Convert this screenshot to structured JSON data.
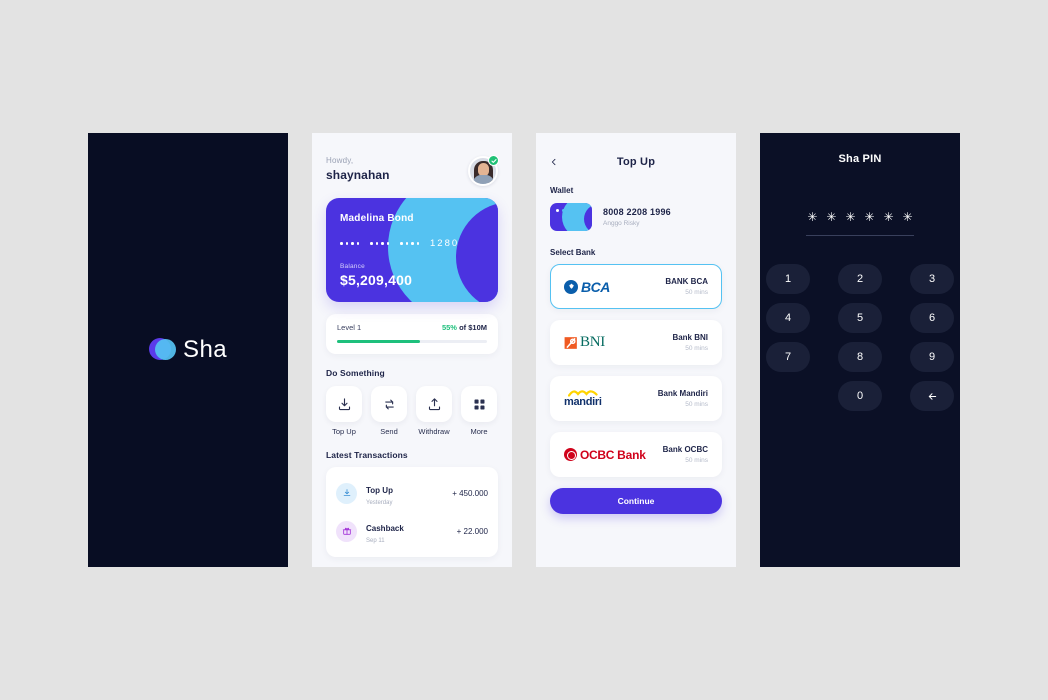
{
  "splash": {
    "brand": "Sha",
    "logo_icon": "sha-logo-icon",
    "bg_color": "#080d23",
    "purple": "#5b3bea",
    "cyan": "#55c2f2"
  },
  "home": {
    "greeting": "Howdy,",
    "username": "shaynahan",
    "avatar_icon": "avatar",
    "verified_icon": "verified-check-icon",
    "card": {
      "holder": "Madelina Bond",
      "masked_groups": [
        "••••",
        "••••",
        "••••"
      ],
      "last4": "1280",
      "balance_label": "Balance",
      "balance": "$5,209,400",
      "bg_color": "#4b33e0",
      "accent_color": "#55c2f2"
    },
    "level": {
      "label": "Level 1",
      "percent_text": "55%",
      "of_text": " of $10M",
      "progress": 55,
      "bar_color": "#1ec07c"
    },
    "do_something_title": "Do Something",
    "actions": [
      {
        "label": "Top Up",
        "icon": "download-tray-icon"
      },
      {
        "label": "Send",
        "icon": "swap-arrows-icon"
      },
      {
        "label": "Withdraw",
        "icon": "upload-tray-icon"
      },
      {
        "label": "More",
        "icon": "grid-icon"
      }
    ],
    "transactions_title": "Latest Transactions",
    "transactions": [
      {
        "title": "Top Up",
        "subtitle": "Yesterday",
        "amount": "+ 450.000",
        "icon": "download-tray-icon",
        "tone": "blue"
      },
      {
        "title": "Cashback",
        "subtitle": "Sep 11",
        "amount": "+ 22.000",
        "icon": "gift-icon",
        "tone": "purple"
      }
    ]
  },
  "topup": {
    "back_icon": "chevron-left-icon",
    "title": "Top Up",
    "wallet_label": "Wallet",
    "wallet": {
      "number": "8008 2208 1996",
      "owner": "Anggo Risky",
      "card_icon": "wallet-card-icon"
    },
    "select_bank_label": "Select Bank",
    "banks": [
      {
        "name": "BANK BCA",
        "time": "50 mins",
        "logo": "bca-logo-icon",
        "selected": true
      },
      {
        "name": "Bank BNI",
        "time": "50 mins",
        "logo": "bni-logo-icon",
        "selected": false
      },
      {
        "name": "Bank Mandiri",
        "time": "50 mins",
        "logo": "mandiri-logo-icon",
        "selected": false
      },
      {
        "name": "Bank OCBC",
        "time": "50 mins",
        "logo": "ocbc-logo-icon",
        "selected": false
      }
    ],
    "continue_label": "Continue"
  },
  "pin": {
    "title": "Sha PIN",
    "mask_char": "＊",
    "mask_count": 6,
    "keys": [
      "1",
      "2",
      "3",
      "4",
      "5",
      "6",
      "7",
      "8",
      "9",
      "",
      "0",
      "backspace"
    ],
    "backspace_icon": "arrow-left-backspace-icon"
  }
}
